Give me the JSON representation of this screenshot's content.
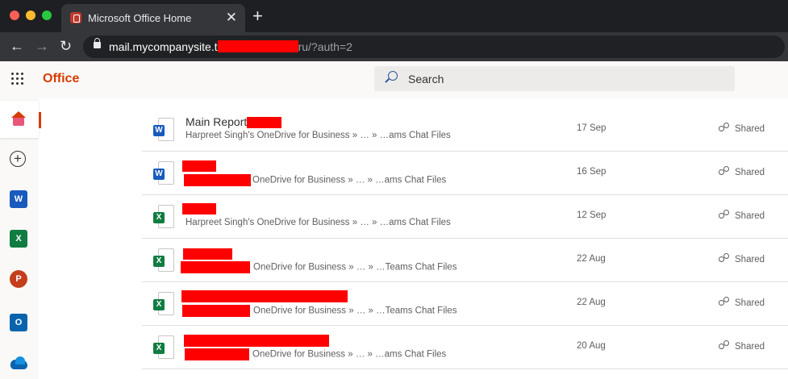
{
  "browser": {
    "tab_title": "Microsoft Office Home",
    "tab_close": "✕",
    "new_tab": "+",
    "url_host": "mail.mycompanysite.t",
    "url_path": "ru/?auth=2"
  },
  "header": {
    "brand": "Office",
    "search_placeholder": "Search"
  },
  "rail": {
    "items": [
      "home-icon",
      "create-icon",
      "word-icon",
      "excel-icon",
      "powerpoint-icon",
      "outlook-icon",
      "onedrive-icon"
    ],
    "letters": {
      "word": "W",
      "excel": "X",
      "ppt": "P",
      "outlook": "O",
      "plus": "+"
    }
  },
  "files": [
    {
      "type": "word",
      "name": "Main Report",
      "path": "Harpreet Singh's OneDrive for Business » … » …ams Chat Files",
      "date": "17 Sep",
      "sharing": "Shared"
    },
    {
      "type": "word",
      "name": "",
      "path": "OneDrive for Business » … » …ams Chat Files",
      "date": "16 Sep",
      "sharing": "Shared"
    },
    {
      "type": "excel",
      "name": "",
      "path": "Harpreet Singh's OneDrive for Business » … » …ams Chat Files",
      "date": "12 Sep",
      "sharing": "Shared"
    },
    {
      "type": "excel",
      "name": "",
      "path": "OneDrive for Business » … » …Teams Chat Files",
      "date": "22 Aug",
      "sharing": "Shared"
    },
    {
      "type": "excel",
      "name": "",
      "path": "OneDrive for Business » … » …Teams Chat Files",
      "date": "22 Aug",
      "sharing": "Shared"
    },
    {
      "type": "excel",
      "name": "",
      "path": "OneDrive for Business » … » …ams Chat Files",
      "date": "20 Aug",
      "sharing": "Shared"
    }
  ],
  "colors": {
    "brand": "#d83b01",
    "word": "#185abd",
    "excel": "#107c41",
    "redaction": "#ff0000"
  }
}
